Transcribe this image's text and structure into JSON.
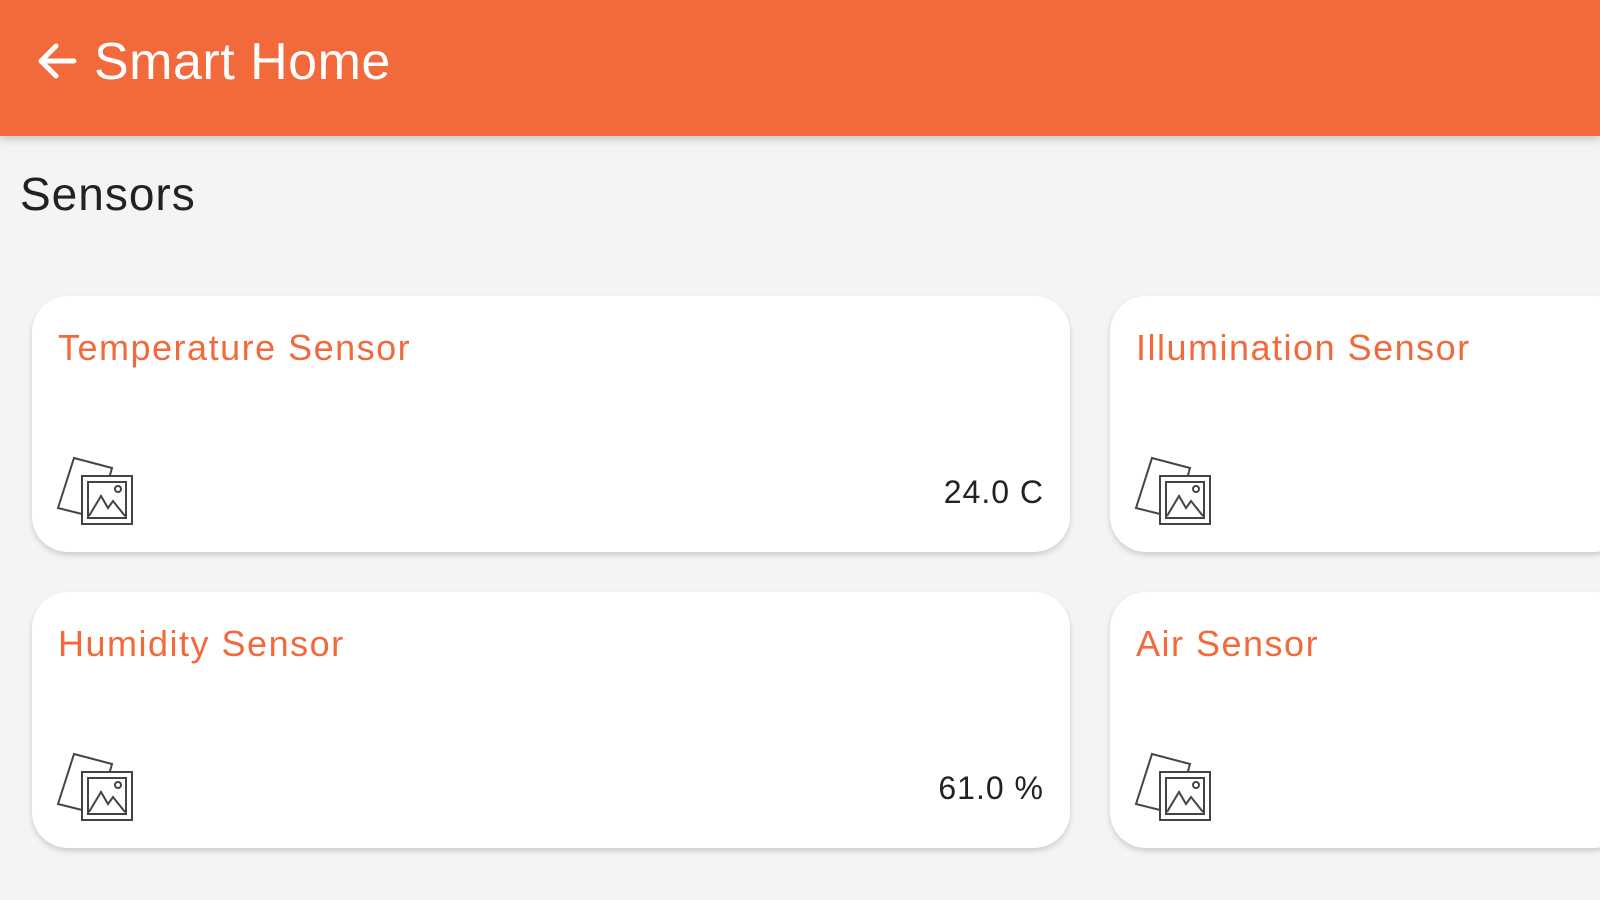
{
  "header": {
    "title": "Smart Home",
    "back_icon": "arrow-left-icon",
    "color": "#f2693b"
  },
  "section": {
    "title": "Sensors"
  },
  "sensors": [
    {
      "name": "Temperature Sensor",
      "value": "24.0 C",
      "icon": "image-placeholder-icon"
    },
    {
      "name": "Illumination Sensor",
      "value": "",
      "icon": "image-placeholder-icon"
    },
    {
      "name": "Humidity Sensor",
      "value": "61.0 %",
      "icon": "image-placeholder-icon"
    },
    {
      "name": "Air Sensor",
      "value": "",
      "icon": "image-placeholder-icon"
    }
  ]
}
